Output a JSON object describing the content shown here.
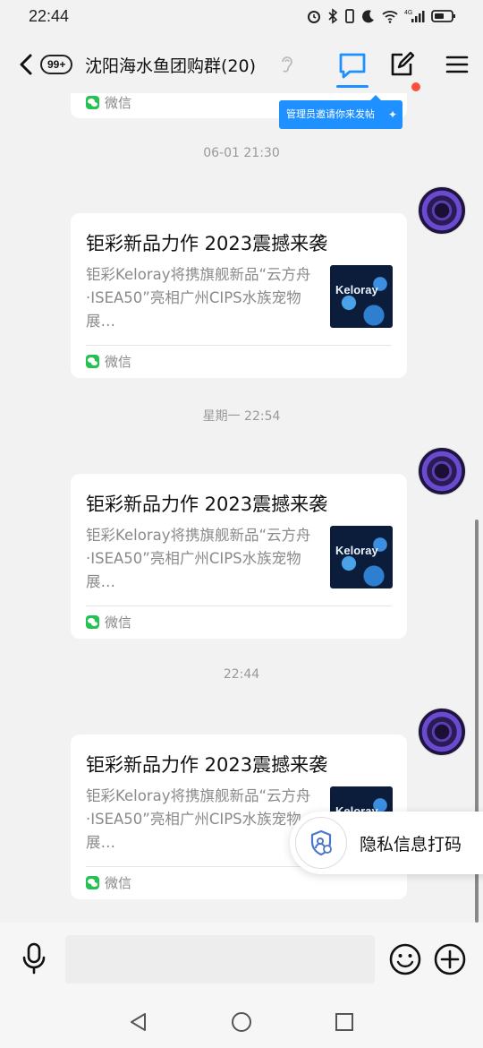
{
  "status_bar": {
    "time": "22:44",
    "network": "4G"
  },
  "header": {
    "unread_badge": "99+",
    "title": "沈阳海水鱼团购群(20)",
    "tooltip": "管理员邀请你来发帖"
  },
  "top_partial_card": {
    "source": "微信"
  },
  "messages": [
    {
      "timestamp": "06-01 21:30",
      "card": {
        "title": "钜彩新品力作 2023震撼来袭",
        "description": "钜彩Keloray将携旗舰新品“云方舟·ISEA50”亮相广州CIPS水族宠物展…",
        "thumb_logo": "Keloray",
        "source": "微信"
      }
    },
    {
      "timestamp": "星期一 22:54",
      "card": {
        "title": "钜彩新品力作 2023震撼来袭",
        "description": "钜彩Keloray将携旗舰新品“云方舟·ISEA50”亮相广州CIPS水族宠物展…",
        "thumb_logo": "Keloray",
        "source": "微信"
      }
    },
    {
      "timestamp": "22:44",
      "card": {
        "title": "钜彩新品力作 2023震撼来袭",
        "description": "钜彩Keloray将携旗舰新品“云方舟·ISEA50”亮相广州CIPS水族宠物展…",
        "thumb_logo": "Keloray",
        "source": "微信"
      }
    }
  ],
  "privacy_popup": {
    "label": "隐私信息打码"
  },
  "input_bar": {
    "placeholder": ""
  },
  "colors": {
    "accent": "#1e90ff",
    "notification_dot": "#ff4d3d",
    "wechat_green": "#24c253"
  }
}
